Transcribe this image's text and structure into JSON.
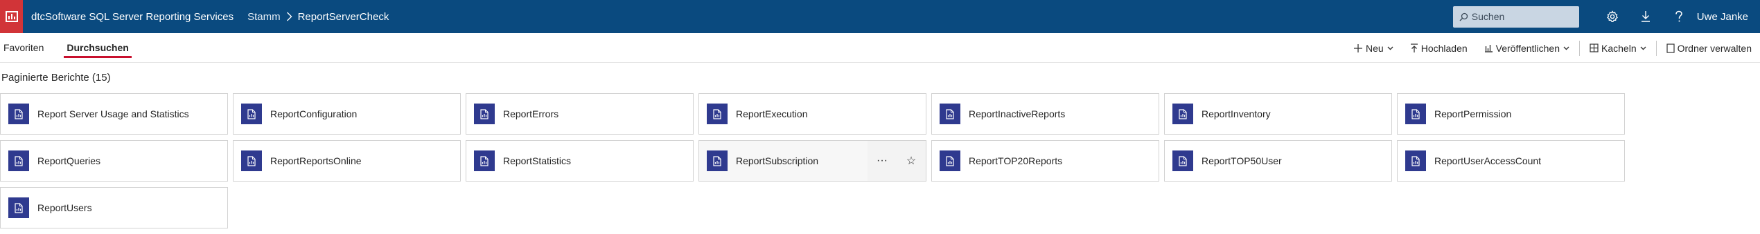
{
  "header": {
    "app_title": "dtcSoftware SQL Server Reporting Services",
    "breadcrumb": {
      "root": "Stamm",
      "current": "ReportServerCheck"
    },
    "search": {
      "placeholder": "Suchen"
    },
    "user_name": "Uwe Janke",
    "icons": [
      "settings-icon",
      "download-icon",
      "help-icon"
    ]
  },
  "tabs": [
    {
      "label": "Favoriten",
      "active": false
    },
    {
      "label": "Durchsuchen",
      "active": true
    }
  ],
  "toolbar": {
    "new_label": "Neu",
    "upload_label": "Hochladen",
    "publish_label": "Veröffentlichen",
    "view_label": "Kacheln",
    "manage_label": "Ordner verwalten"
  },
  "section": {
    "title": "Paginierte Berichte (15)"
  },
  "reports": [
    {
      "name": "Report Server Usage and Statistics"
    },
    {
      "name": "ReportConfiguration"
    },
    {
      "name": "ReportErrors"
    },
    {
      "name": "ReportExecution"
    },
    {
      "name": "ReportInactiveReports"
    },
    {
      "name": "ReportInventory"
    },
    {
      "name": "ReportPermission"
    },
    {
      "name": "ReportQueries"
    },
    {
      "name": "ReportReportsOnline"
    },
    {
      "name": "ReportStatistics"
    },
    {
      "name": "ReportSubscription",
      "hovered": true
    },
    {
      "name": "ReportTOP20Reports"
    },
    {
      "name": "ReportTOP50User"
    },
    {
      "name": "ReportUserAccessCount"
    },
    {
      "name": "ReportUsers"
    }
  ],
  "hover_tools": {
    "more_label": "···",
    "favorite_label": "☆"
  },
  "colors": {
    "header_bg": "#0a4a7f",
    "logo_bg": "#d13438",
    "tile_icon_bg": "#2f3a8f",
    "active_tab_underline": "#c8102e"
  }
}
